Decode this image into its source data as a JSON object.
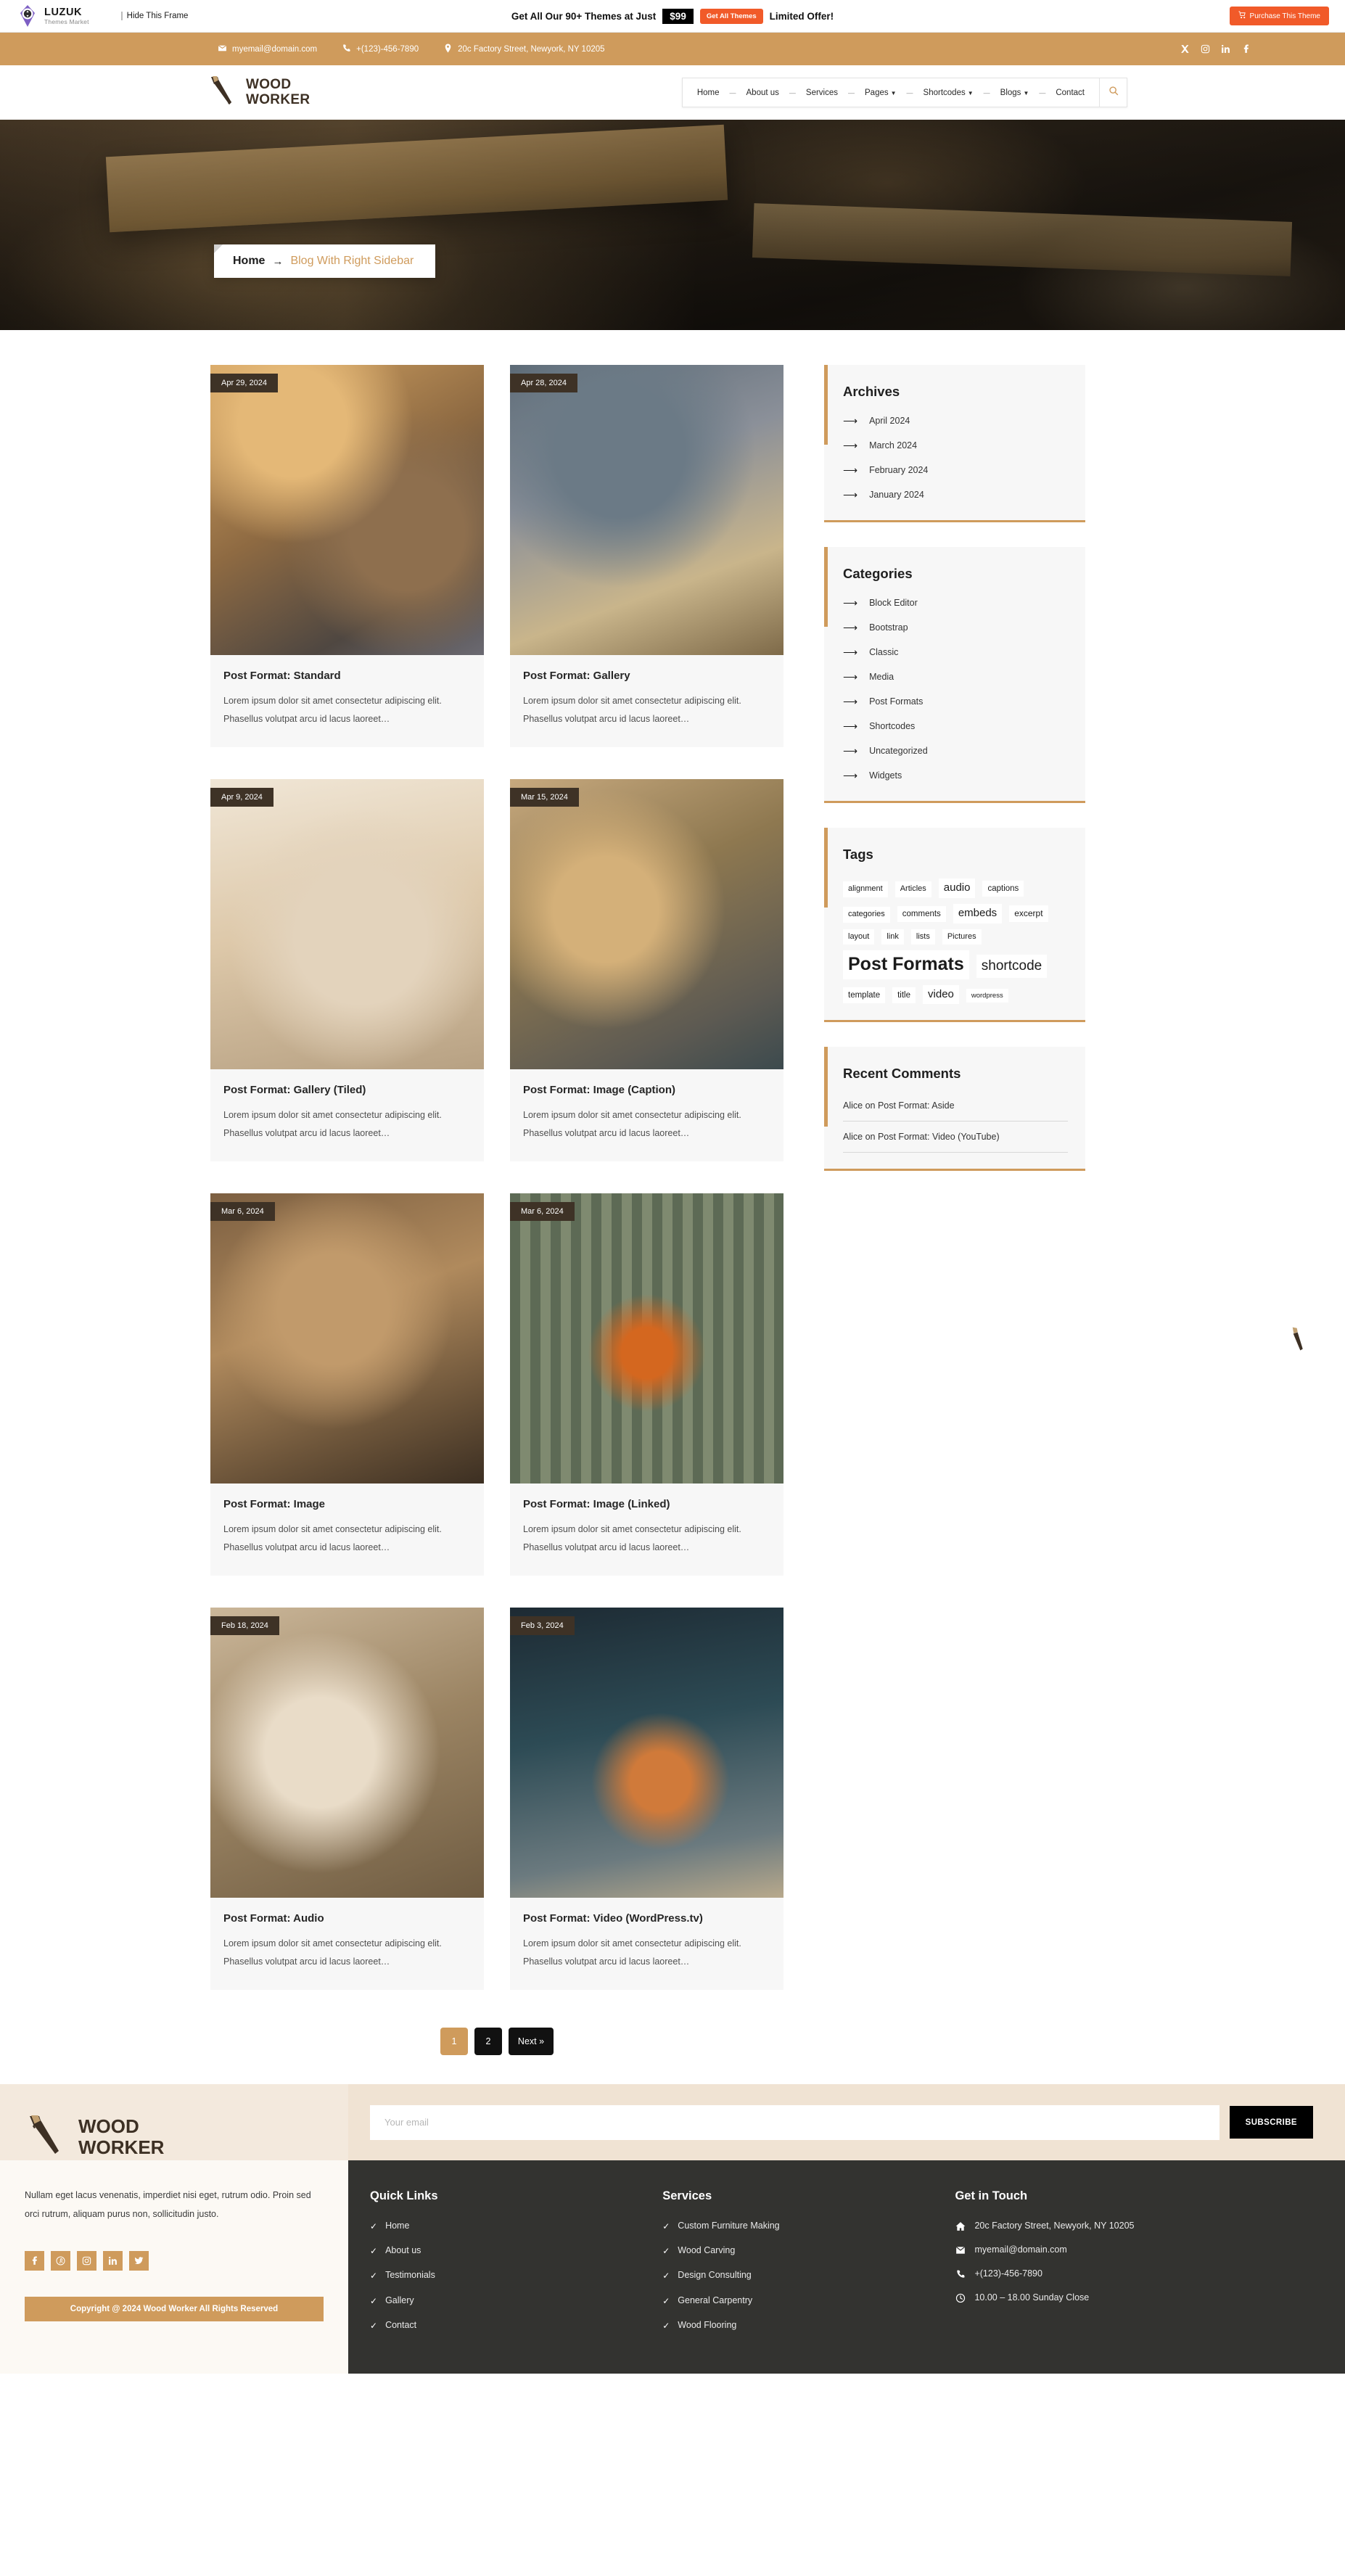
{
  "promo": {
    "logo_main": "LUZUK",
    "logo_sub": "Themes Market",
    "hide_frame": "Hide This Frame",
    "headline": "Get All Our 90+ Themes at Just",
    "price": "$99",
    "cta": "Get All Themes",
    "limited": "Limited Offer!",
    "purchase": "Purchase This Theme"
  },
  "contact_bar": {
    "email": "myemail@domain.com",
    "phone": "+(123)-456-7890",
    "address": "20c Factory Street, Newyork, NY 10205",
    "socials": [
      "x-icon",
      "instagram-icon",
      "linkedin-icon",
      "facebook-icon"
    ]
  },
  "header": {
    "brand_line1": "WOOD",
    "brand_line2": "WORKER",
    "nav": [
      {
        "label": "Home",
        "has_caret": false
      },
      {
        "label": "About us",
        "has_caret": false
      },
      {
        "label": "Services",
        "has_caret": false
      },
      {
        "label": "Pages",
        "has_caret": true
      },
      {
        "label": "Shortcodes",
        "has_caret": true
      },
      {
        "label": "Blogs",
        "has_caret": true
      },
      {
        "label": "Contact",
        "has_caret": false
      }
    ],
    "search_icon": "search-icon"
  },
  "hero": {
    "breadcrumb_home": "Home",
    "breadcrumb_arrow": "→",
    "breadcrumb_current": "Blog With Right Sidebar"
  },
  "posts": [
    {
      "date": "Apr 29, 2024",
      "title": "Post Format: Standard",
      "excerpt": "Lorem ipsum dolor sit amet consectetur adipiscing elit. Phasellus volutpat arcu id lacus laoreet…",
      "photo": "ph-standard"
    },
    {
      "date": "Apr 28, 2024",
      "title": "Post Format: Gallery",
      "excerpt": "Lorem ipsum dolor sit amet consectetur adipiscing elit. Phasellus volutpat arcu id lacus laoreet…",
      "photo": "ph-gallery"
    },
    {
      "date": "Apr 9, 2024",
      "title": "Post Format: Gallery (Tiled)",
      "excerpt": "Lorem ipsum dolor sit amet consectetur adipiscing elit. Phasellus volutpat arcu id lacus laoreet…",
      "photo": "ph-tiled"
    },
    {
      "date": "Mar 15, 2024",
      "title": "Post Format: Image (Caption)",
      "excerpt": "Lorem ipsum dolor sit amet consectetur adipiscing elit. Phasellus volutpat arcu id lacus laoreet…",
      "photo": "ph-caption"
    },
    {
      "date": "Mar 6, 2024",
      "title": "Post Format: Image",
      "excerpt": "Lorem ipsum dolor sit amet consectetur adipiscing elit. Phasellus volutpat arcu id lacus laoreet…",
      "photo": "ph-image"
    },
    {
      "date": "Mar 6, 2024",
      "title": "Post Format: Image (Linked)",
      "excerpt": "Lorem ipsum dolor sit amet consectetur adipiscing elit. Phasellus volutpat arcu id lacus laoreet…",
      "photo": "ph-linked"
    },
    {
      "date": "Feb 18, 2024",
      "title": "Post Format: Audio",
      "excerpt": "Lorem ipsum dolor sit amet consectetur adipiscing elit. Phasellus volutpat arcu id lacus laoreet…",
      "photo": "ph-audio"
    },
    {
      "date": "Feb 3, 2024",
      "title": "Post Format: Video (WordPress.tv)",
      "excerpt": "Lorem ipsum dolor sit amet consectetur adipiscing elit. Phasellus volutpat arcu id lacus laoreet…",
      "photo": "ph-video"
    }
  ],
  "pagination": [
    {
      "label": "1",
      "active": true
    },
    {
      "label": "2",
      "active": false
    },
    {
      "label": "Next »",
      "active": false
    }
  ],
  "sidebar": {
    "archives": {
      "title": "Archives",
      "items": [
        "April 2024",
        "March 2024",
        "February 2024",
        "January 2024"
      ]
    },
    "categories": {
      "title": "Categories",
      "items": [
        "Block Editor",
        "Bootstrap",
        "Classic",
        "Media",
        "Post Formats",
        "Shortcodes",
        "Uncategorized",
        "Widgets"
      ]
    },
    "tags": {
      "title": "Tags",
      "items": [
        {
          "label": "alignment",
          "size": 11
        },
        {
          "label": "Articles",
          "size": 11
        },
        {
          "label": "audio",
          "size": 15
        },
        {
          "label": "captions",
          "size": 11.5
        },
        {
          "label": "categories",
          "size": 11
        },
        {
          "label": "comments",
          "size": 11.5
        },
        {
          "label": "embeds",
          "size": 15
        },
        {
          "label": "excerpt",
          "size": 12
        },
        {
          "label": "layout",
          "size": 11
        },
        {
          "label": "link",
          "size": 11
        },
        {
          "label": "lists",
          "size": 11
        },
        {
          "label": "Pictures",
          "size": 11
        },
        {
          "label": "Post Formats",
          "size": 25
        },
        {
          "label": "shortcode",
          "size": 19
        },
        {
          "label": "template",
          "size": 11.5
        },
        {
          "label": "title",
          "size": 11.5
        },
        {
          "label": "video",
          "size": 15
        },
        {
          "label": "wordpress",
          "size": 9.5
        }
      ]
    },
    "recent_comments": {
      "title": "Recent Comments",
      "items": [
        "Alice on Post Format: Aside",
        "Alice on Post Format: Video (YouTube)"
      ]
    }
  },
  "footer": {
    "brand_line1": "WOOD",
    "brand_line2": "WORKER",
    "newsletter_placeholder": "Your email",
    "subscribe_label": "SUBSCRIBE",
    "description": "Nullam eget lacus venenatis, imperdiet nisi eget, rutrum odio. Proin sed orci rutrum, aliquam purus non, sollicitudin justo.",
    "socials": [
      "facebook-icon",
      "pinterest-icon",
      "instagram-icon",
      "linkedin-icon",
      "twitter-icon"
    ],
    "copyright": "Copyright @ 2024 Wood Worker All Rights Reserved",
    "quick_links": {
      "title": "Quick Links",
      "items": [
        "Home",
        "About us",
        "Testimonials",
        "Gallery",
        "Contact"
      ]
    },
    "services": {
      "title": "Services",
      "items": [
        "Custom Furniture Making",
        "Wood Carving",
        "Design Consulting",
        "General Carpentry",
        "Wood Flooring"
      ]
    },
    "get_in_touch": {
      "title": "Get in Touch",
      "address": "20c Factory Street, Newyork, NY 10205",
      "email": "myemail@domain.com",
      "phone": "+(123)-456-7890",
      "hours": "10.00 – 18.00 Sunday Close"
    }
  },
  "colors": {
    "accent": "#cf9b5c",
    "promo_orange": "#f15a29",
    "dark": "#333330",
    "card_bg": "#f7f7f7"
  }
}
